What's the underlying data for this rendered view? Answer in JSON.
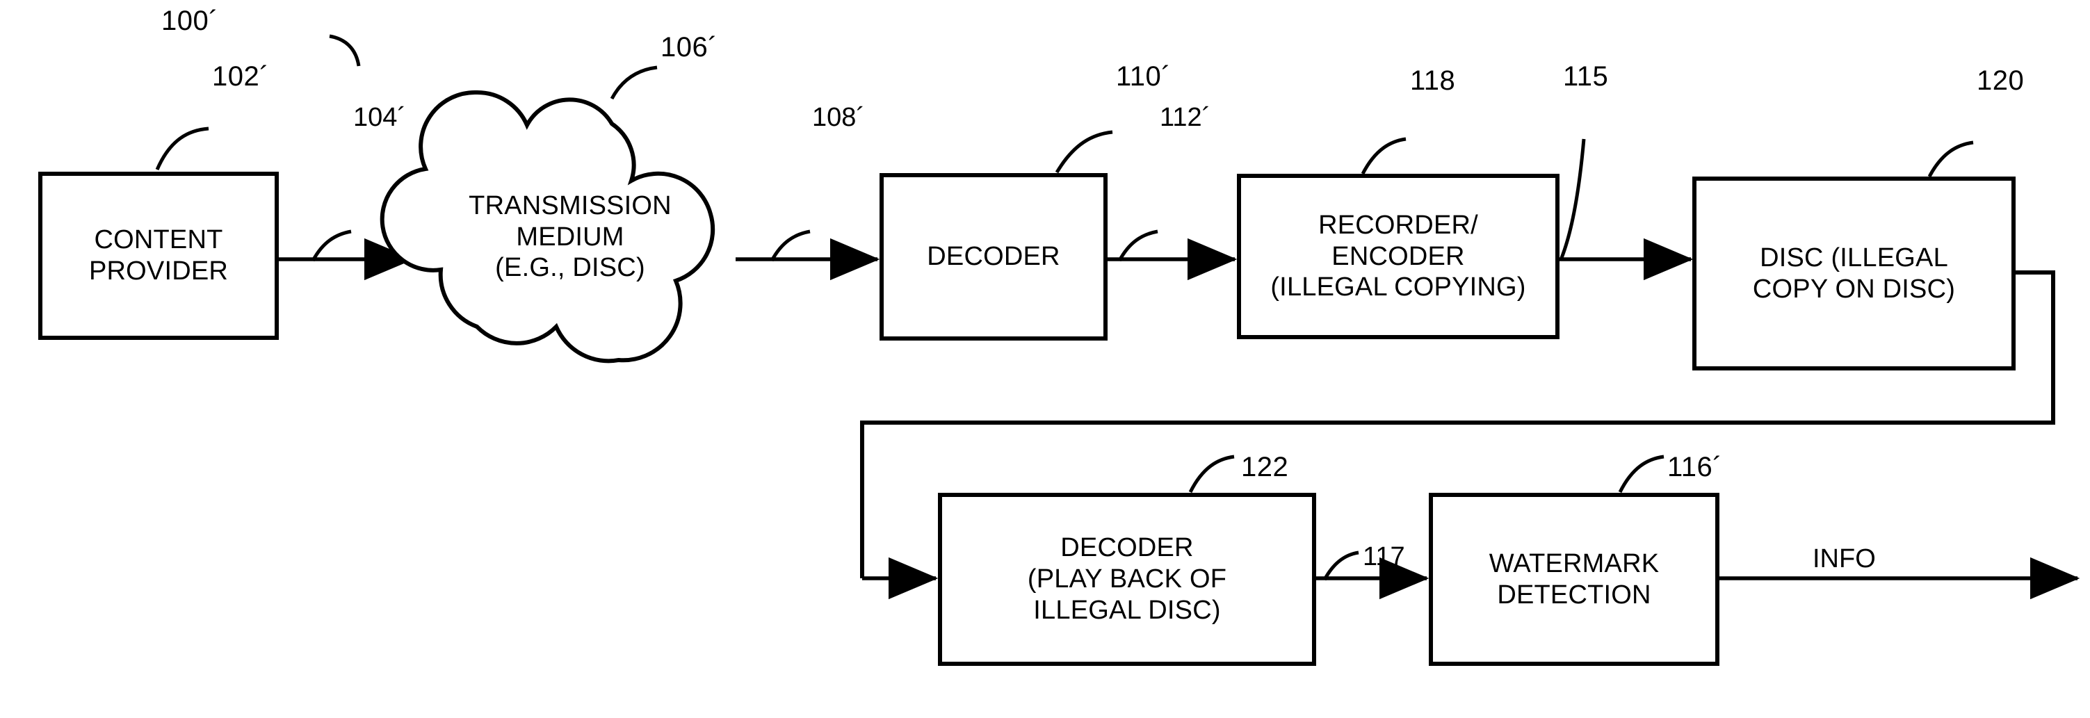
{
  "figure": {
    "figure_ref": "100´",
    "boxes": [
      {
        "id": "content-provider",
        "ref": "102´",
        "lines": [
          "CONTENT",
          "PROVIDER"
        ]
      },
      {
        "id": "transmission-medium",
        "ref": "106´",
        "lines": [
          "TRANSMISSION",
          "MEDIUM",
          "(E.G., DISC)"
        ]
      },
      {
        "id": "decoder",
        "ref": "110´",
        "lines": [
          "DECODER"
        ]
      },
      {
        "id": "recorder-encoder",
        "ref": "118",
        "lines": [
          "RECORDER/",
          "ENCODER",
          "(ILLEGAL COPYING)"
        ]
      },
      {
        "id": "disc-illegal-copy",
        "ref": "120",
        "lines": [
          "DISC (ILLEGAL",
          "COPY ON DISC)"
        ]
      },
      {
        "id": "decoder-playback",
        "ref": "122",
        "lines": [
          "DECODER",
          "(PLAY BACK OF",
          "ILLEGAL DISC)"
        ]
      },
      {
        "id": "watermark-detection",
        "ref": "116´",
        "lines": [
          "WATERMARK",
          "DETECTION"
        ]
      }
    ],
    "flow_refs": {
      "provider_to_medium": "104´",
      "medium_to_decoder": "108´",
      "decoder_to_recorder": "112´",
      "recorder_to_disc": "115",
      "playback_to_watermark": "117"
    },
    "output_label": "INFO",
    "colors": {
      "stroke": "#000000",
      "background": "#ffffff"
    }
  }
}
